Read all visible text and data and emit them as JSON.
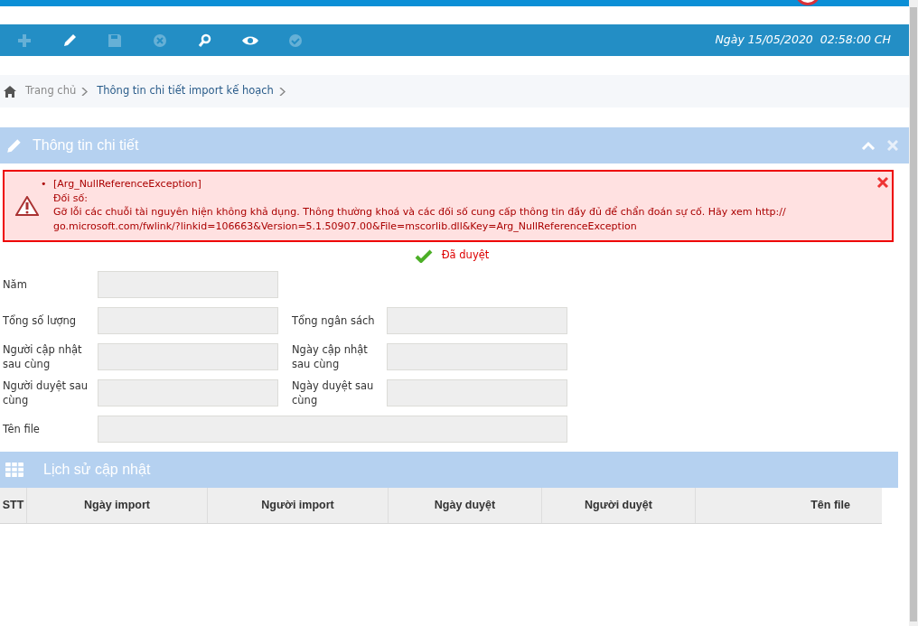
{
  "toolbar": {
    "buttons": [
      {
        "kind": "add",
        "disabled": true
      },
      {
        "kind": "edit",
        "disabled": false
      },
      {
        "kind": "save",
        "disabled": true
      },
      {
        "kind": "cancel",
        "disabled": true
      },
      {
        "kind": "search",
        "disabled": false
      },
      {
        "kind": "view",
        "disabled": false
      },
      {
        "kind": "approve",
        "disabled": true
      }
    ],
    "datetime": "Ngày 15/05/2020  02:58:00 CH"
  },
  "breadcrumb": [
    {
      "label": "Trang chủ",
      "kind": "home"
    },
    {
      "label": "Thông tin chi tiết import kế hoạch",
      "kind": "page"
    }
  ],
  "detail_panel": {
    "title": "Thông tin chi tiết",
    "error": {
      "bullet": "•",
      "lines": [
        "[Arg_NullReferenceException]",
        "Đối số:",
        "Gỡ lỗi các chuỗi tài nguyên hiện không khả dụng. Thông thường khoá và các đối số cung cấp thông tin đầy đủ để chẩn đoán sự cố. Hãy xem http:// go.microsoft.com/fwlink/?linkid=106663&Version=5.1.50907.00&File=mscorlib.dll&Key=Arg_NullReferenceException"
      ]
    },
    "status": "Đã duyệt",
    "form_rows": [
      [
        {
          "label": "Năm",
          "disabled": true
        }
      ],
      [
        {
          "label": "Tổng số lượng",
          "disabled": true
        },
        {
          "label": "Tổng ngân sách",
          "disabled": true
        }
      ],
      [
        {
          "label": "Người cập nhật sau cùng",
          "disabled": true
        },
        {
          "label": "Ngày cập nhật sau cùng",
          "disabled": true
        }
      ],
      [
        {
          "label": "Người duyệt sau cùng",
          "disabled": true
        },
        {
          "label": "Ngày duyệt sau cùng",
          "disabled": true
        }
      ],
      [
        {
          "label": "Tên file",
          "disabled": true,
          "wide": true
        }
      ]
    ]
  },
  "history_panel": {
    "title": "Lịch sử cập nhật",
    "table": {
      "columns": [
        "STT",
        "Ngày import",
        "Người import",
        "Ngày duyệt",
        "Người duyệt",
        "Tên file"
      ]
    }
  }
}
